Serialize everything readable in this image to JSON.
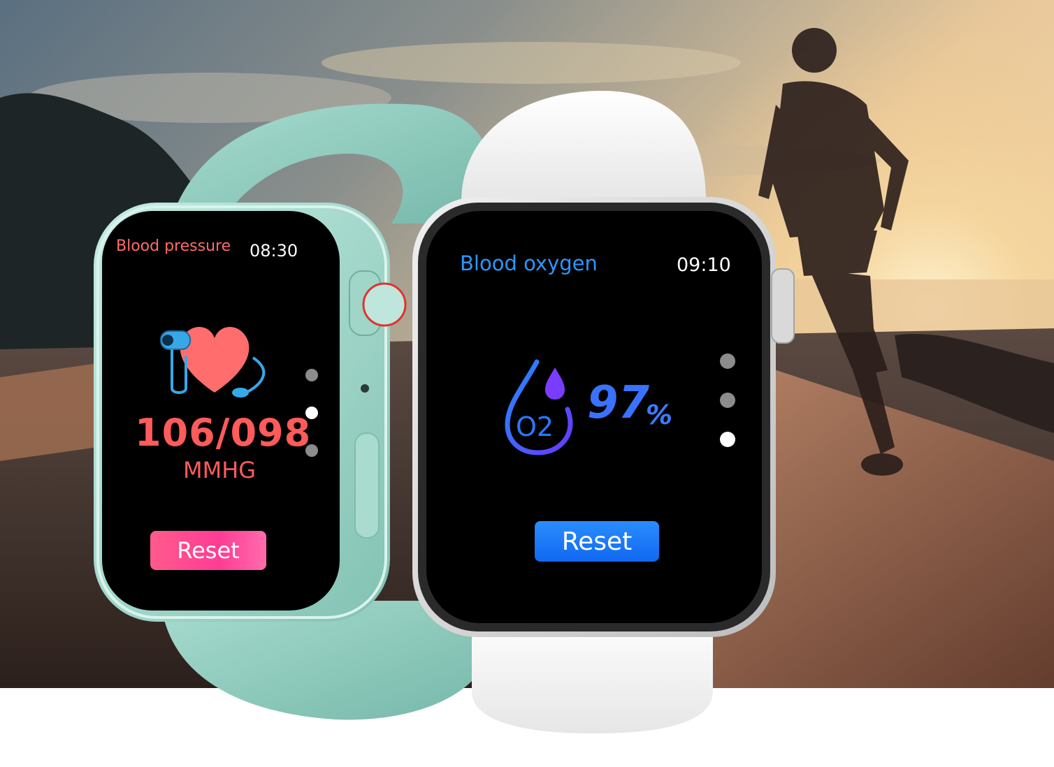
{
  "colors": {
    "bp_accent": "#ff5b5b",
    "bp_button": "#ff3c95",
    "ox_accent": "#2a97ff",
    "ox_button": "#1068f0",
    "green_band": "#8fcbbf",
    "white_band": "#f5f5f5"
  },
  "watch_green": {
    "title": "Blood pressure",
    "time": "08:30",
    "reading": "106/098",
    "unit": "MMHG",
    "reset_label": "Reset",
    "icon": "blood-pressure-heart-icon",
    "page_indicator": {
      "total": 3,
      "active": 2
    }
  },
  "watch_white": {
    "title": "Blood oxygen",
    "time": "09:10",
    "value": "97",
    "value_unit": "%",
    "reset_label": "Reset",
    "icon": "oxygen-drop-icon",
    "icon_text": "O2",
    "page_indicator": {
      "total": 3,
      "active": 3
    }
  }
}
